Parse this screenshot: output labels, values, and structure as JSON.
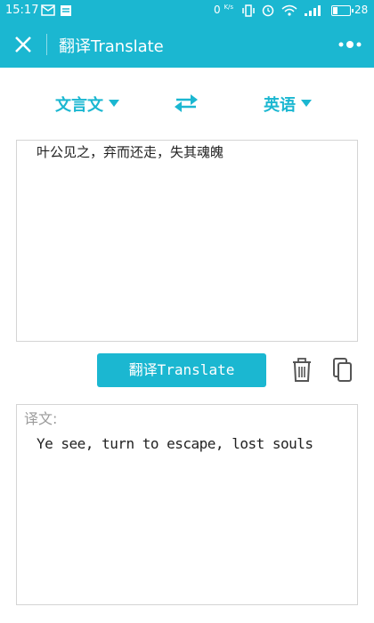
{
  "status_bar": {
    "time": "15:17",
    "network_speed": "0",
    "network_unit": "K/s",
    "battery_level": "28",
    "battery_fraction": 0.28
  },
  "app_bar": {
    "title": "翻译Translate"
  },
  "languages": {
    "source": "文言文",
    "target": "英语"
  },
  "source": {
    "text": "叶公见之，弃而还走，失其魂魄"
  },
  "actions": {
    "translate_label": "翻译Translate"
  },
  "result": {
    "label": "译文:",
    "text": "Ye see, turn to escape, lost souls"
  },
  "colors": {
    "accent": "#1bb7d1",
    "border": "#d4d4d4"
  },
  "icons": [
    "close-icon",
    "more-icon",
    "swap-icon",
    "trash-icon",
    "copy-icon"
  ]
}
